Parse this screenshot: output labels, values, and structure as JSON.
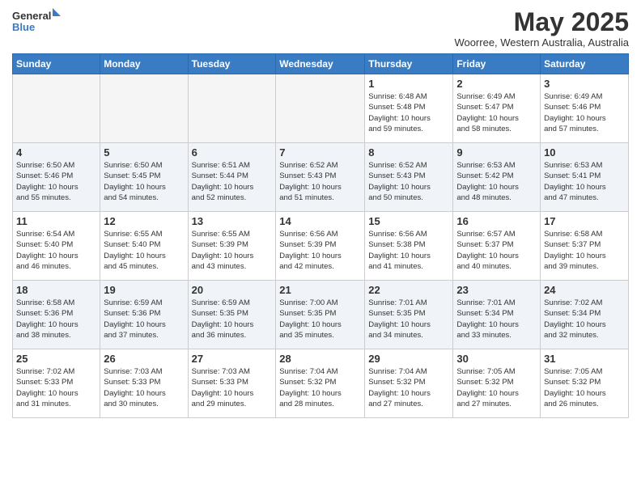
{
  "header": {
    "logo_text_general": "General",
    "logo_text_blue": "Blue",
    "month_title": "May 2025",
    "location": "Woorree, Western Australia, Australia"
  },
  "weekdays": [
    "Sunday",
    "Monday",
    "Tuesday",
    "Wednesday",
    "Thursday",
    "Friday",
    "Saturday"
  ],
  "weeks": [
    {
      "shade": false,
      "days": [
        {
          "num": "",
          "info": ""
        },
        {
          "num": "",
          "info": ""
        },
        {
          "num": "",
          "info": ""
        },
        {
          "num": "",
          "info": ""
        },
        {
          "num": "1",
          "info": "Sunrise: 6:48 AM\nSunset: 5:48 PM\nDaylight: 10 hours\nand 59 minutes."
        },
        {
          "num": "2",
          "info": "Sunrise: 6:49 AM\nSunset: 5:47 PM\nDaylight: 10 hours\nand 58 minutes."
        },
        {
          "num": "3",
          "info": "Sunrise: 6:49 AM\nSunset: 5:46 PM\nDaylight: 10 hours\nand 57 minutes."
        }
      ]
    },
    {
      "shade": true,
      "days": [
        {
          "num": "4",
          "info": "Sunrise: 6:50 AM\nSunset: 5:46 PM\nDaylight: 10 hours\nand 55 minutes."
        },
        {
          "num": "5",
          "info": "Sunrise: 6:50 AM\nSunset: 5:45 PM\nDaylight: 10 hours\nand 54 minutes."
        },
        {
          "num": "6",
          "info": "Sunrise: 6:51 AM\nSunset: 5:44 PM\nDaylight: 10 hours\nand 52 minutes."
        },
        {
          "num": "7",
          "info": "Sunrise: 6:52 AM\nSunset: 5:43 PM\nDaylight: 10 hours\nand 51 minutes."
        },
        {
          "num": "8",
          "info": "Sunrise: 6:52 AM\nSunset: 5:43 PM\nDaylight: 10 hours\nand 50 minutes."
        },
        {
          "num": "9",
          "info": "Sunrise: 6:53 AM\nSunset: 5:42 PM\nDaylight: 10 hours\nand 48 minutes."
        },
        {
          "num": "10",
          "info": "Sunrise: 6:53 AM\nSunset: 5:41 PM\nDaylight: 10 hours\nand 47 minutes."
        }
      ]
    },
    {
      "shade": false,
      "days": [
        {
          "num": "11",
          "info": "Sunrise: 6:54 AM\nSunset: 5:40 PM\nDaylight: 10 hours\nand 46 minutes."
        },
        {
          "num": "12",
          "info": "Sunrise: 6:55 AM\nSunset: 5:40 PM\nDaylight: 10 hours\nand 45 minutes."
        },
        {
          "num": "13",
          "info": "Sunrise: 6:55 AM\nSunset: 5:39 PM\nDaylight: 10 hours\nand 43 minutes."
        },
        {
          "num": "14",
          "info": "Sunrise: 6:56 AM\nSunset: 5:39 PM\nDaylight: 10 hours\nand 42 minutes."
        },
        {
          "num": "15",
          "info": "Sunrise: 6:56 AM\nSunset: 5:38 PM\nDaylight: 10 hours\nand 41 minutes."
        },
        {
          "num": "16",
          "info": "Sunrise: 6:57 AM\nSunset: 5:37 PM\nDaylight: 10 hours\nand 40 minutes."
        },
        {
          "num": "17",
          "info": "Sunrise: 6:58 AM\nSunset: 5:37 PM\nDaylight: 10 hours\nand 39 minutes."
        }
      ]
    },
    {
      "shade": true,
      "days": [
        {
          "num": "18",
          "info": "Sunrise: 6:58 AM\nSunset: 5:36 PM\nDaylight: 10 hours\nand 38 minutes."
        },
        {
          "num": "19",
          "info": "Sunrise: 6:59 AM\nSunset: 5:36 PM\nDaylight: 10 hours\nand 37 minutes."
        },
        {
          "num": "20",
          "info": "Sunrise: 6:59 AM\nSunset: 5:35 PM\nDaylight: 10 hours\nand 36 minutes."
        },
        {
          "num": "21",
          "info": "Sunrise: 7:00 AM\nSunset: 5:35 PM\nDaylight: 10 hours\nand 35 minutes."
        },
        {
          "num": "22",
          "info": "Sunrise: 7:01 AM\nSunset: 5:35 PM\nDaylight: 10 hours\nand 34 minutes."
        },
        {
          "num": "23",
          "info": "Sunrise: 7:01 AM\nSunset: 5:34 PM\nDaylight: 10 hours\nand 33 minutes."
        },
        {
          "num": "24",
          "info": "Sunrise: 7:02 AM\nSunset: 5:34 PM\nDaylight: 10 hours\nand 32 minutes."
        }
      ]
    },
    {
      "shade": false,
      "days": [
        {
          "num": "25",
          "info": "Sunrise: 7:02 AM\nSunset: 5:33 PM\nDaylight: 10 hours\nand 31 minutes."
        },
        {
          "num": "26",
          "info": "Sunrise: 7:03 AM\nSunset: 5:33 PM\nDaylight: 10 hours\nand 30 minutes."
        },
        {
          "num": "27",
          "info": "Sunrise: 7:03 AM\nSunset: 5:33 PM\nDaylight: 10 hours\nand 29 minutes."
        },
        {
          "num": "28",
          "info": "Sunrise: 7:04 AM\nSunset: 5:32 PM\nDaylight: 10 hours\nand 28 minutes."
        },
        {
          "num": "29",
          "info": "Sunrise: 7:04 AM\nSunset: 5:32 PM\nDaylight: 10 hours\nand 27 minutes."
        },
        {
          "num": "30",
          "info": "Sunrise: 7:05 AM\nSunset: 5:32 PM\nDaylight: 10 hours\nand 27 minutes."
        },
        {
          "num": "31",
          "info": "Sunrise: 7:05 AM\nSunset: 5:32 PM\nDaylight: 10 hours\nand 26 minutes."
        }
      ]
    }
  ]
}
